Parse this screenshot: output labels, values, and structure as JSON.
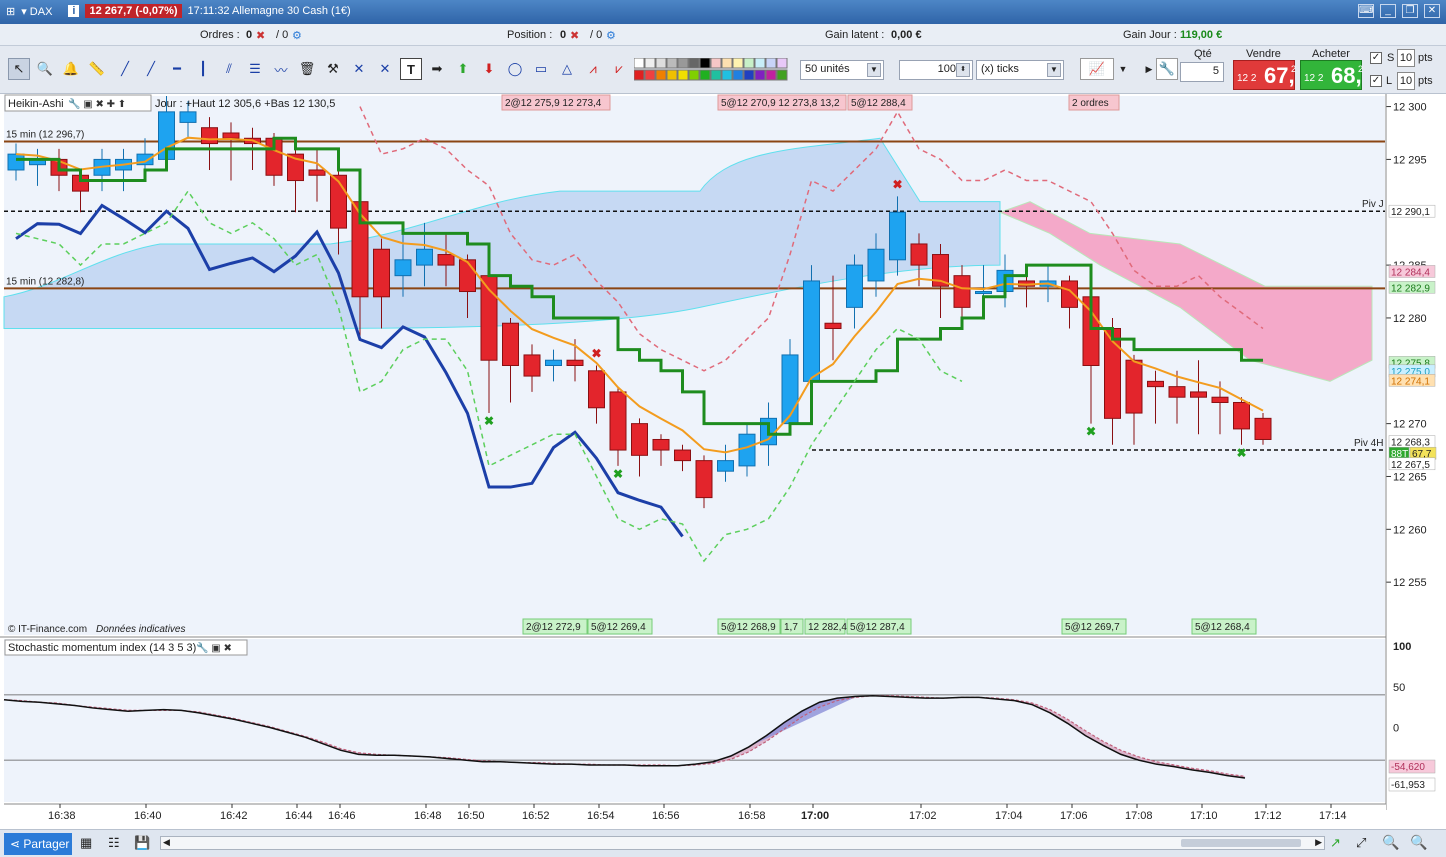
{
  "title_bar": {
    "instrument": "DAX",
    "quote": "12 267,7 (-0,07%)",
    "time_and_name": "17:11:32 Allemagne 30 Cash (1€)"
  },
  "info_bar": {
    "orders_label": "Ordres :",
    "orders_value": "0",
    "orders_value2": "/ 0",
    "position_label": "Position :",
    "position_value": "0",
    "position_value2": "/ 0",
    "latent_label": "Gain latent :",
    "latent_value": "0,00 €",
    "day_label": "Gain Jour :",
    "day_value": "119,00 €"
  },
  "toolbar": {
    "units_select": "50 unités",
    "ticks_value": "100",
    "ticks_unit": "(x) ticks",
    "qty_label": "Qté",
    "qty_value": "5",
    "sell_label": "Vendre",
    "buy_label": "Acheter",
    "sell_small": "12 2",
    "sell_big": "67,",
    "sell_sup": "2",
    "buy_small": "12 2",
    "buy_big": "68,",
    "buy_sup": "2",
    "s_label": "S",
    "s_value": "10",
    "s_unit": "pts",
    "l_label": "L",
    "l_value": "10",
    "l_unit": "pts"
  },
  "price_panel": {
    "indicator_label": "Heikin-Ashi",
    "ohlc_text": "Jour : +Haut 12 305,6 +Bas 12 130,5",
    "level1_label": "15 min (12 296,7)",
    "level2_label": "15 min (12 282,8)",
    "piv_j": "Piv J",
    "piv_4h": "Piv 4H",
    "copyright": "© IT-Finance.com",
    "disclaimer": "Données indicatives",
    "top_orders": [
      "2@12 275,9 12 273,4",
      "5@12 270,9 12 273,8 13,2",
      "5@12 288,4",
      "2 ordres"
    ],
    "bottom_orders": [
      "2@12 272,9",
      "5@12 269,4",
      "5@12 268,9",
      "1,7",
      "12 282,4",
      "5@12 287,4",
      "5@12 269,7",
      "5@12 268,4"
    ],
    "y_ticks": [
      "12 300",
      "12 295",
      "12 285",
      "12 280",
      "12 270",
      "12 265",
      "12 260",
      "12 255"
    ],
    "price_tags": [
      {
        "text": "12 290,1",
        "bg": "#ffffff",
        "fg": "#222222"
      },
      {
        "text": "12 284,4",
        "bg": "#f7c9da",
        "fg": "#b0305a"
      },
      {
        "text": "12 282,9",
        "bg": "#c9f2c9",
        "fg": "#1a7a1a"
      },
      {
        "text": "12 275,8",
        "bg": "#c9f2c9",
        "fg": "#1a7a1a"
      },
      {
        "text": "12 275,0",
        "bg": "#c9efff",
        "fg": "#20a0c0"
      },
      {
        "text": "12 274,1",
        "bg": "#ffe0b0",
        "fg": "#d07000"
      },
      {
        "text": "12 268,3",
        "bg": "#ffffff",
        "fg": "#222222"
      },
      {
        "text": "88T",
        "bg": "#2ea82e",
        "fg": "#ffffff"
      },
      {
        "text": "67,7",
        "bg": "#f3e25a",
        "fg": "#222222"
      },
      {
        "text": "12 267,5",
        "bg": "#ffffff",
        "fg": "#222222"
      }
    ]
  },
  "oscillator_panel": {
    "label": "Stochastic momentum index (14 3 5 3)",
    "y_ticks": [
      "100",
      "50",
      "0"
    ],
    "value_tags": [
      {
        "text": "-54,620",
        "bg": "#f7c9da",
        "fg": "#b0305a"
      },
      {
        "text": "-61,953",
        "bg": "#ffffff",
        "fg": "#222222"
      }
    ]
  },
  "x_axis": {
    "ticks": [
      "16:38",
      "16:40",
      "16:42",
      "16:44",
      "16:46",
      "16:48",
      "16:50",
      "16:52",
      "16:54",
      "16:56",
      "16:58",
      "17:00",
      "17:02",
      "17:04",
      "17:06",
      "17:08",
      "17:10",
      "17:12",
      "17:14"
    ]
  },
  "status_bar": {
    "share_label": "Partager"
  },
  "chart_data": {
    "type": "heikin-ashi candlestick",
    "ylim": [
      12250,
      12301
    ],
    "candles": [
      {
        "open": 12294,
        "close": 12295.5,
        "high": 12296.5,
        "low": 12293
      },
      {
        "open": 12294.5,
        "close": 12295,
        "high": 12296,
        "low": 12292.5
      },
      {
        "open": 12295,
        "close": 12293.5,
        "high": 12296,
        "low": 12292
      },
      {
        "open": 12293.5,
        "close": 12292,
        "high": 12294,
        "low": 12290
      },
      {
        "open": 12293.5,
        "close": 12295,
        "high": 12296,
        "low": 12292
      },
      {
        "open": 12294,
        "close": 12295,
        "high": 12296,
        "low": 12292
      },
      {
        "open": 12294.5,
        "close": 12295.5,
        "high": 12297,
        "low": 12293
      },
      {
        "open": 12295,
        "close": 12299.5,
        "high": 12301,
        "low": 12294
      },
      {
        "open": 12298.5,
        "close": 12299.5,
        "high": 12300.5,
        "low": 12297
      },
      {
        "open": 12298,
        "close": 12296.5,
        "high": 12299,
        "low": 12294
      },
      {
        "open": 12297.5,
        "close": 12297,
        "high": 12298.5,
        "low": 12293
      },
      {
        "open": 12297,
        "close": 12296.5,
        "high": 12298,
        "low": 12294
      },
      {
        "open": 12297,
        "close": 12293.5,
        "high": 12297.5,
        "low": 12292.5
      },
      {
        "open": 12295.5,
        "close": 12293,
        "high": 12296.5,
        "low": 12290
      },
      {
        "open": 12294,
        "close": 12293.5,
        "high": 12296,
        "low": 12291
      },
      {
        "open": 12293.5,
        "close": 12288.5,
        "high": 12294,
        "low": 12286
      },
      {
        "open": 12291,
        "close": 12282,
        "high": 12292,
        "low": 12278
      },
      {
        "open": 12286.5,
        "close": 12282,
        "high": 12287.5,
        "low": 12279
      },
      {
        "open": 12284,
        "close": 12285.5,
        "high": 12288,
        "low": 12282
      },
      {
        "open": 12285,
        "close": 12286.5,
        "high": 12289,
        "low": 12283
      },
      {
        "open": 12286,
        "close": 12285,
        "high": 12288,
        "low": 12283
      },
      {
        "open": 12285.5,
        "close": 12282.5,
        "high": 12286,
        "low": 12280
      },
      {
        "open": 12284,
        "close": 12276,
        "high": 12284.5,
        "low": 12271
      },
      {
        "open": 12279.5,
        "close": 12275.5,
        "high": 12280,
        "low": 12272
      },
      {
        "open": 12276.5,
        "close": 12274.5,
        "high": 12277.5,
        "low": 12273
      },
      {
        "open": 12275.5,
        "close": 12276,
        "high": 12277,
        "low": 12274
      },
      {
        "open": 12276,
        "close": 12275.5,
        "high": 12278,
        "low": 12274
      },
      {
        "open": 12275,
        "close": 12271.5,
        "high": 12275.5,
        "low": 12270
      },
      {
        "open": 12273,
        "close": 12267.5,
        "high": 12273.5,
        "low": 12266
      },
      {
        "open": 12270,
        "close": 12267,
        "high": 12270.5,
        "low": 12265
      },
      {
        "open": 12268.5,
        "close": 12267.5,
        "high": 12269,
        "low": 12266
      },
      {
        "open": 12267.5,
        "close": 12266.5,
        "high": 12268,
        "low": 12265.5
      },
      {
        "open": 12266.5,
        "close": 12263,
        "high": 12267,
        "low": 12262
      },
      {
        "open": 12265.5,
        "close": 12266.5,
        "high": 12268,
        "low": 12264.5
      },
      {
        "open": 12266,
        "close": 12269,
        "high": 12270,
        "low": 12265
      },
      {
        "open": 12268,
        "close": 12270.5,
        "high": 12272,
        "low": 12266
      },
      {
        "open": 12270,
        "close": 12276.5,
        "high": 12278,
        "low": 12269
      },
      {
        "open": 12274,
        "close": 12283.5,
        "high": 12285,
        "low": 12273
      },
      {
        "open": 12279.5,
        "close": 12279,
        "high": 12284,
        "low": 12276
      },
      {
        "open": 12281,
        "close": 12285,
        "high": 12286,
        "low": 12279
      },
      {
        "open": 12283.5,
        "close": 12286.5,
        "high": 12288,
        "low": 12282
      },
      {
        "open": 12285.5,
        "close": 12290,
        "high": 12291.5,
        "low": 12284
      },
      {
        "open": 12287,
        "close": 12285,
        "high": 12288,
        "low": 12283
      },
      {
        "open": 12286,
        "close": 12283,
        "high": 12287,
        "low": 12280
      },
      {
        "open": 12284,
        "close": 12281,
        "high": 12285,
        "low": 12279
      },
      {
        "open": 12282.5,
        "close": 12282.5,
        "high": 12285,
        "low": 12280
      },
      {
        "open": 12282.5,
        "close": 12284.5,
        "high": 12286,
        "low": 12281
      },
      {
        "open": 12283.5,
        "close": 12283,
        "high": 12285,
        "low": 12281
      },
      {
        "open": 12283,
        "close": 12283.5,
        "high": 12285,
        "low": 12281.5
      },
      {
        "open": 12283.5,
        "close": 12281,
        "high": 12284,
        "low": 12279
      },
      {
        "open": 12282,
        "close": 12275.5,
        "high": 12283,
        "low": 12270
      },
      {
        "open": 12279,
        "close": 12270.5,
        "high": 12280,
        "low": 12268
      },
      {
        "open": 12276,
        "close": 12271,
        "high": 12276.5,
        "low": 12268
      },
      {
        "open": 12274,
        "close": 12273.5,
        "high": 12275,
        "low": 12270
      },
      {
        "open": 12273.5,
        "close": 12272.5,
        "high": 12275,
        "low": 12270
      },
      {
        "open": 12273,
        "close": 12272.5,
        "high": 12276,
        "low": 12269
      },
      {
        "open": 12272.5,
        "close": 12272,
        "high": 12274,
        "low": 12269
      },
      {
        "open": 12272,
        "close": 12269.5,
        "high": 12272.5,
        "low": 12268
      },
      {
        "open": 12270.5,
        "close": 12268.5,
        "high": 12271,
        "low": 12268
      }
    ],
    "overlays": {
      "resistance_15min_1": 12296.7,
      "resistance_15min_2": 12282.8,
      "pivot_daily": 12290.1,
      "pivot_4h": 12267.5,
      "ma_orange_last": 12274.1,
      "ma_green_last": 12275.8
    },
    "oscillator": {
      "name": "Stochastic momentum index (14 3 5 3)",
      "ylim": [
        -100,
        100
      ],
      "levels": [
        40,
        -40
      ],
      "last_values": [
        -54.62,
        -61.953
      ],
      "smi": [
        34,
        32,
        31,
        29,
        27,
        24,
        22,
        20,
        21,
        22,
        21,
        18,
        14,
        10,
        5,
        0,
        -6,
        -12,
        -20,
        -28,
        -33,
        -34,
        -34,
        -35,
        -36,
        -38,
        -40,
        -42,
        -42,
        -43,
        -44,
        -45,
        -45,
        -46,
        -46,
        -46,
        -47,
        -47,
        -47,
        -45,
        -42,
        -35,
        -24,
        -10,
        6,
        20,
        31,
        36,
        38,
        39,
        38,
        37,
        36,
        36,
        37,
        37,
        35,
        33,
        28,
        18,
        5,
        -10,
        -22,
        -33,
        -40,
        -45,
        -48,
        -52,
        -55,
        -59,
        -62
      ],
      "signal": [
        34,
        33,
        31,
        30,
        27,
        25,
        23,
        21,
        21,
        21,
        21,
        19,
        15,
        11,
        6,
        1,
        -5,
        -11,
        -18,
        -26,
        -31,
        -33,
        -34,
        -35,
        -36,
        -37,
        -39,
        -41,
        -42,
        -43,
        -43,
        -44,
        -45,
        -45,
        -46,
        -46,
        -46,
        -46,
        -47,
        -46,
        -44,
        -39,
        -30,
        -17,
        -2,
        13,
        25,
        33,
        37,
        39,
        39,
        38,
        37,
        36,
        37,
        37,
        36,
        34,
        30,
        22,
        10,
        -4,
        -17,
        -28,
        -36,
        -42,
        -46,
        -50,
        -53,
        -57,
        -60
      ]
    }
  }
}
